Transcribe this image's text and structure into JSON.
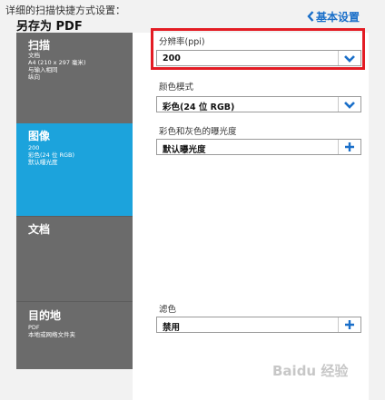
{
  "header": {
    "title": "详细的扫描快捷方式设置：",
    "subtitle": "另存为 PDF",
    "back_label": "基本设置"
  },
  "sections": {
    "scan": {
      "name": "扫描",
      "lines": [
        "文档",
        "A4 (210 x 297 毫米)",
        "与输入相同",
        "纵向"
      ]
    },
    "image": {
      "name": "图像",
      "lines": [
        "200",
        "彩色(24 位 RGB)",
        "默认曝光度"
      ]
    },
    "document": {
      "name": "文档"
    },
    "destination": {
      "name": "目的地",
      "lines": [
        "PDF",
        "本地或网络文件夹"
      ]
    }
  },
  "settings": {
    "resolution": {
      "label": "分辨率(ppi)",
      "value": "200"
    },
    "color_mode": {
      "label": "颜色模式",
      "value": "彩色(24 位 RGB)"
    },
    "exposure": {
      "label": "彩色和灰色的曝光度",
      "value": "默认曝光度"
    },
    "filter": {
      "label": "滤色",
      "value": "禁用"
    }
  },
  "watermark": "Baidu 经验",
  "colors": {
    "accent": "#1ca3dc",
    "highlight": "#e31c24",
    "sidebar": "#6b6b6b",
    "link": "#1a6fc9"
  },
  "icons": {
    "back": "chevron-left-icon",
    "dropdown": "chevron-down-icon",
    "expand": "plus-icon"
  }
}
